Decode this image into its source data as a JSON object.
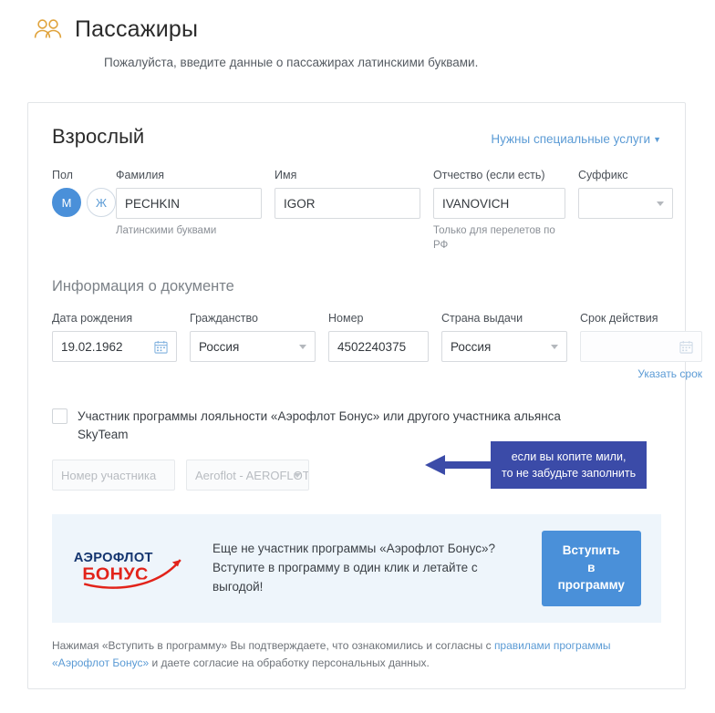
{
  "header": {
    "icon": "people-icon",
    "title": "Пассажиры",
    "subtitle": "Пожалуйста, введите данные о пассажирах латинскими буквами."
  },
  "card": {
    "title": "Взрослый",
    "special_services_link": "Нужны специальные услуги",
    "special_services_caret": "▼",
    "name_fields": {
      "gender": {
        "label": "Пол",
        "male_option": "М",
        "female_option": "Ж",
        "selected": "М"
      },
      "last_name": {
        "label": "Фамилия",
        "value": "PECHKIN",
        "hint": "Латинскими буквами"
      },
      "first_name": {
        "label": "Имя",
        "value": "IGOR"
      },
      "middle_name": {
        "label": "Отчество (если есть)",
        "value": "IVANOVICH",
        "hint": "Только для перелетов по РФ"
      },
      "suffix": {
        "label": "Суффикс",
        "value": ""
      }
    },
    "document_section": {
      "title": "Информация о документе",
      "birth_date": {
        "label": "Дата рождения",
        "value": "19.02.1962",
        "icon": "calendar-icon"
      },
      "citizenship": {
        "label": "Гражданство",
        "value": "Россия"
      },
      "number": {
        "label": "Номер",
        "value": "4502240375"
      },
      "issuing_country": {
        "label": "Страна выдачи",
        "value": "Россия"
      },
      "expiry": {
        "label": "Срок действия",
        "value": "",
        "icon": "calendar-icon",
        "sub_link": "Указать срок",
        "disabled": true
      }
    },
    "loyalty": {
      "checkbox_label": "Участник программы лояльности «Аэрофлот Бонус» или другого участника альянса SkyTeam",
      "checked": false,
      "member_number_placeholder": "Номер участника",
      "airline_value": "Aeroflot - AEROFLOT"
    },
    "callout": {
      "line1": "если вы копите мили,",
      "line2": "то не забудьте заполнить",
      "color": "#3b4ba8"
    },
    "banner": {
      "logo_top": "АЭРОФЛОТ",
      "logo_bottom": "БОНУС",
      "text": "Еще не участник программы «Аэрофлот Бонус»? Вступите в программу в один клик и летайте с выгодой!",
      "button_line1": "Вступить в",
      "button_line2": "программу"
    },
    "legal": {
      "part1": "Нажимая «Вступить в программу» Вы подтверждаете, что ознакомились и согласны с ",
      "link": "правилами программы «Аэрофлот Бонус»",
      "part2": " и даете согласие на обработку персональных данных."
    }
  },
  "colors": {
    "accent_blue": "#4a90d9",
    "link_blue": "#5b9bd5",
    "callout_indigo": "#3b4ba8",
    "icon_gold": "#e8a33d",
    "logo_navy": "#1b3c78",
    "logo_red": "#e2231a",
    "banner_bg": "#eef5fb"
  }
}
